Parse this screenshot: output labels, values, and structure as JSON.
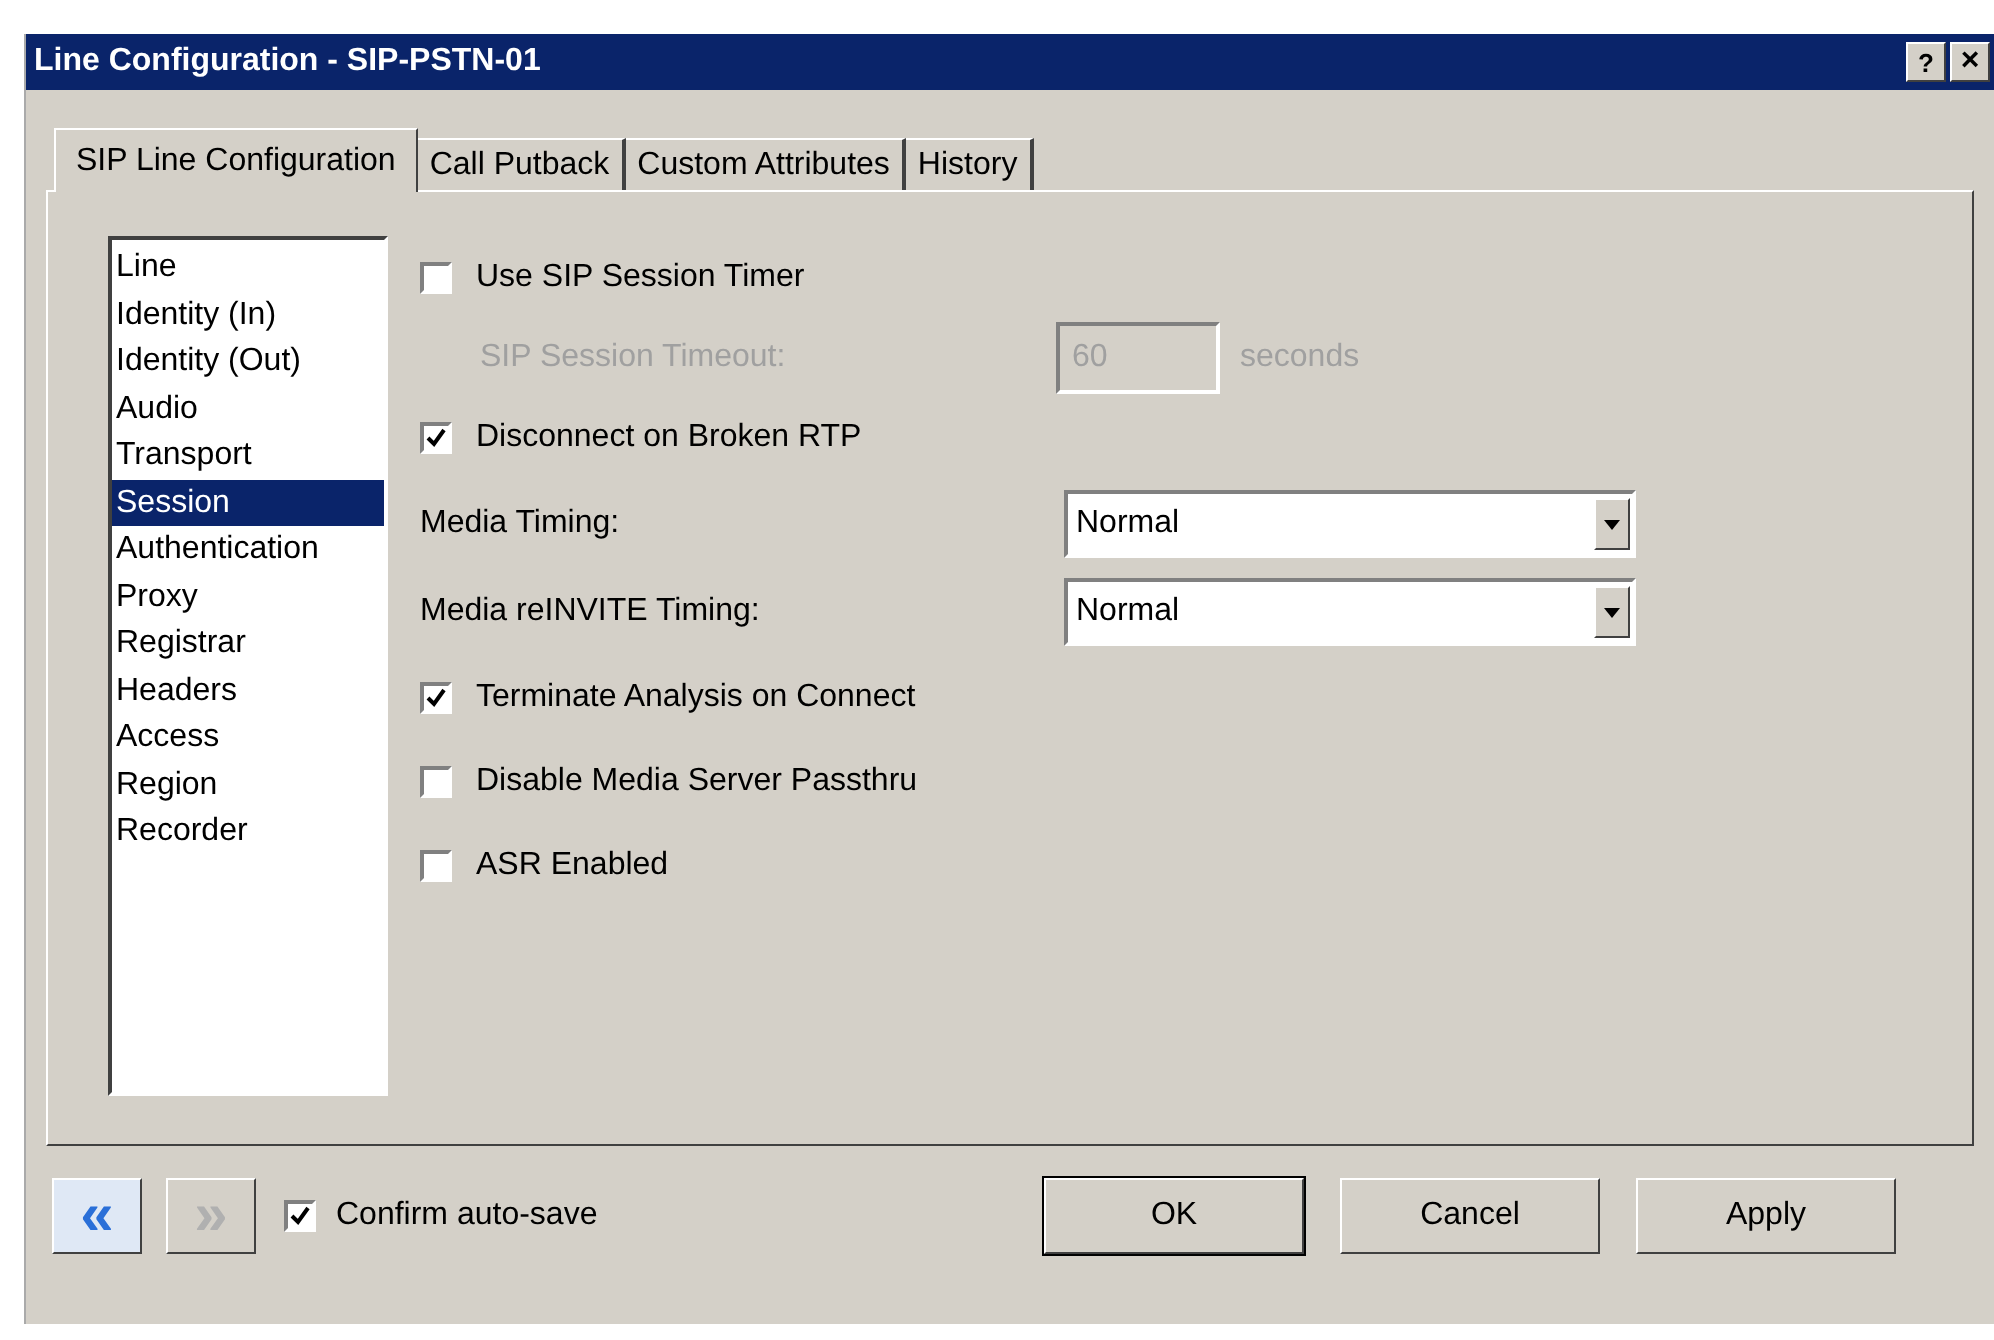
{
  "window": {
    "title": "Line Configuration - SIP-PSTN-01",
    "help": "?",
    "close": "×"
  },
  "tabs": [
    {
      "label": "SIP Line Configuration",
      "selected": true
    },
    {
      "label": "Call Putback",
      "selected": false
    },
    {
      "label": "Custom Attributes",
      "selected": false
    },
    {
      "label": "History",
      "selected": false
    }
  ],
  "sections": [
    {
      "label": "Line",
      "selected": false
    },
    {
      "label": "Identity (In)",
      "selected": false
    },
    {
      "label": "Identity (Out)",
      "selected": false
    },
    {
      "label": "Audio",
      "selected": false
    },
    {
      "label": "Transport",
      "selected": false
    },
    {
      "label": "Session",
      "selected": true
    },
    {
      "label": "Authentication",
      "selected": false
    },
    {
      "label": "Proxy",
      "selected": false
    },
    {
      "label": "Registrar",
      "selected": false
    },
    {
      "label": "Headers",
      "selected": false
    },
    {
      "label": "Access",
      "selected": false
    },
    {
      "label": "Region",
      "selected": false
    },
    {
      "label": "Recorder",
      "selected": false
    }
  ],
  "settings": [
    {
      "kind": "checkbox",
      "label": "Use SIP Session Timer",
      "checked": false
    },
    {
      "kind": "number",
      "label": "SIP Session Timeout:",
      "value": "60",
      "unit": "seconds",
      "disabled": true
    },
    {
      "kind": "checkbox",
      "label": "Disconnect on Broken RTP",
      "checked": true
    },
    {
      "kind": "select",
      "label": "Media Timing:",
      "value": "Normal"
    },
    {
      "kind": "select",
      "label": "Media reINVITE Timing:",
      "value": "Normal"
    },
    {
      "kind": "checkbox",
      "label": "Terminate Analysis on Connect",
      "checked": true
    },
    {
      "kind": "checkbox",
      "label": "Disable Media Server Passthru",
      "checked": false
    },
    {
      "kind": "checkbox",
      "label": "ASR Enabled",
      "checked": false
    }
  ],
  "footer": {
    "back": {
      "label": "«",
      "disabled": false
    },
    "forward": {
      "label": "»",
      "disabled": true
    },
    "confirm_auto_save": {
      "label": "Confirm auto-save",
      "checked": true
    },
    "buttons": [
      "OK",
      "Cancel",
      "Apply"
    ]
  }
}
